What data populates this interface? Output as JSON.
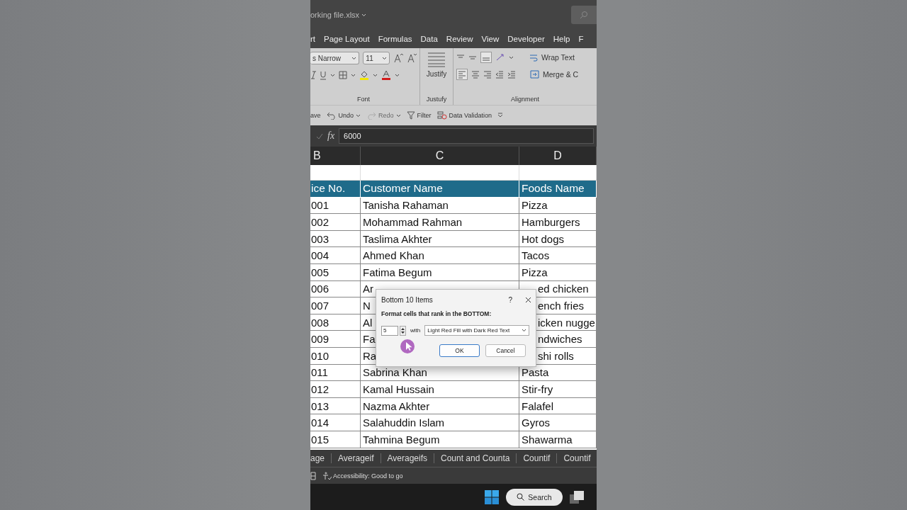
{
  "window": {
    "title": "orking file.xlsx"
  },
  "menu_tabs": [
    "rt",
    "Page Layout",
    "Formulas",
    "Data",
    "Review",
    "View",
    "Developer",
    "Help",
    "F"
  ],
  "ribbon": {
    "font_name": "s Narrow",
    "font_size": "11",
    "justify_label": "Justify",
    "wrap_text": "Wrap Text",
    "merge": "Merge & C",
    "groups": [
      "Font",
      "Justufy",
      "Alignment"
    ]
  },
  "quick_access": [
    {
      "kind": "text",
      "label": "ave",
      "disabled": false
    },
    {
      "kind": "undo",
      "label": "Undo",
      "disabled": false
    },
    {
      "kind": "redo",
      "label": "Redo",
      "disabled": true
    },
    {
      "kind": "filter",
      "label": "Filter",
      "disabled": false
    },
    {
      "kind": "validation",
      "label": "Data Validation",
      "disabled": false
    }
  ],
  "formula_bar": {
    "fx": "fx",
    "value": "6000"
  },
  "columns": [
    "B",
    "C",
    "D"
  ],
  "sheet": {
    "header": [
      "ice No.",
      "Customer Name",
      "Foods Name"
    ],
    "rows": [
      {
        "cells": [
          "001",
          "Tanisha Rahaman",
          "Pizza"
        ],
        "covered": false
      },
      {
        "cells": [
          "002",
          "Mohammad Rahman",
          "Hamburgers"
        ],
        "covered": false
      },
      {
        "cells": [
          "003",
          "Taslima Akhter",
          "Hot dogs"
        ],
        "covered": false
      },
      {
        "cells": [
          "004",
          "Ahmed Khan",
          "Tacos"
        ],
        "covered": false
      },
      {
        "cells": [
          "005",
          "Fatima Begum",
          "Pizza"
        ],
        "covered": false
      },
      {
        "cells": [
          "006",
          "Ar",
          "ed chicken"
        ],
        "covered": true
      },
      {
        "cells": [
          "007",
          "N",
          "ench fries"
        ],
        "covered": true
      },
      {
        "cells": [
          "008",
          "Al",
          "icken nugge"
        ],
        "covered": true
      },
      {
        "cells": [
          "009",
          "Fa",
          "ndwiches"
        ],
        "covered": true
      },
      {
        "cells": [
          "010",
          "Ra",
          "shi rolls"
        ],
        "covered": true
      },
      {
        "cells": [
          "011",
          "Sabrina Khan",
          "Pasta"
        ],
        "covered": false
      },
      {
        "cells": [
          "012",
          "Kamal Hussain",
          "Stir-fry"
        ],
        "covered": false
      },
      {
        "cells": [
          "013",
          "Nazma Akhter",
          "Falafel"
        ],
        "covered": false
      },
      {
        "cells": [
          "014",
          "Salahuddin Islam",
          "Gyros"
        ],
        "covered": false
      },
      {
        "cells": [
          "015",
          "Tahmina Begum",
          "Shawarma"
        ],
        "covered": false
      }
    ]
  },
  "sheet_tabs": [
    {
      "label": "age",
      "selected": false
    },
    {
      "label": "Averageif",
      "selected": false
    },
    {
      "label": "Averageifs",
      "selected": false
    },
    {
      "label": "Count and Counta",
      "selected": false
    },
    {
      "label": "Countif",
      "selected": false
    },
    {
      "label": "Countif",
      "selected": false
    }
  ],
  "status_bar": {
    "text": "Accessibility: Good to go"
  },
  "taskbar": {
    "search": "Search"
  },
  "dialog": {
    "title": "Bottom 10 Items",
    "help": "?",
    "label": "Format cells that rank in the BOTTOM:",
    "count": "5",
    "with": "with",
    "format": "Light Red Fill with Dark Red Text",
    "buttons": [
      {
        "label": "OK",
        "default": true
      },
      {
        "label": "Cancel",
        "default": false
      }
    ]
  }
}
